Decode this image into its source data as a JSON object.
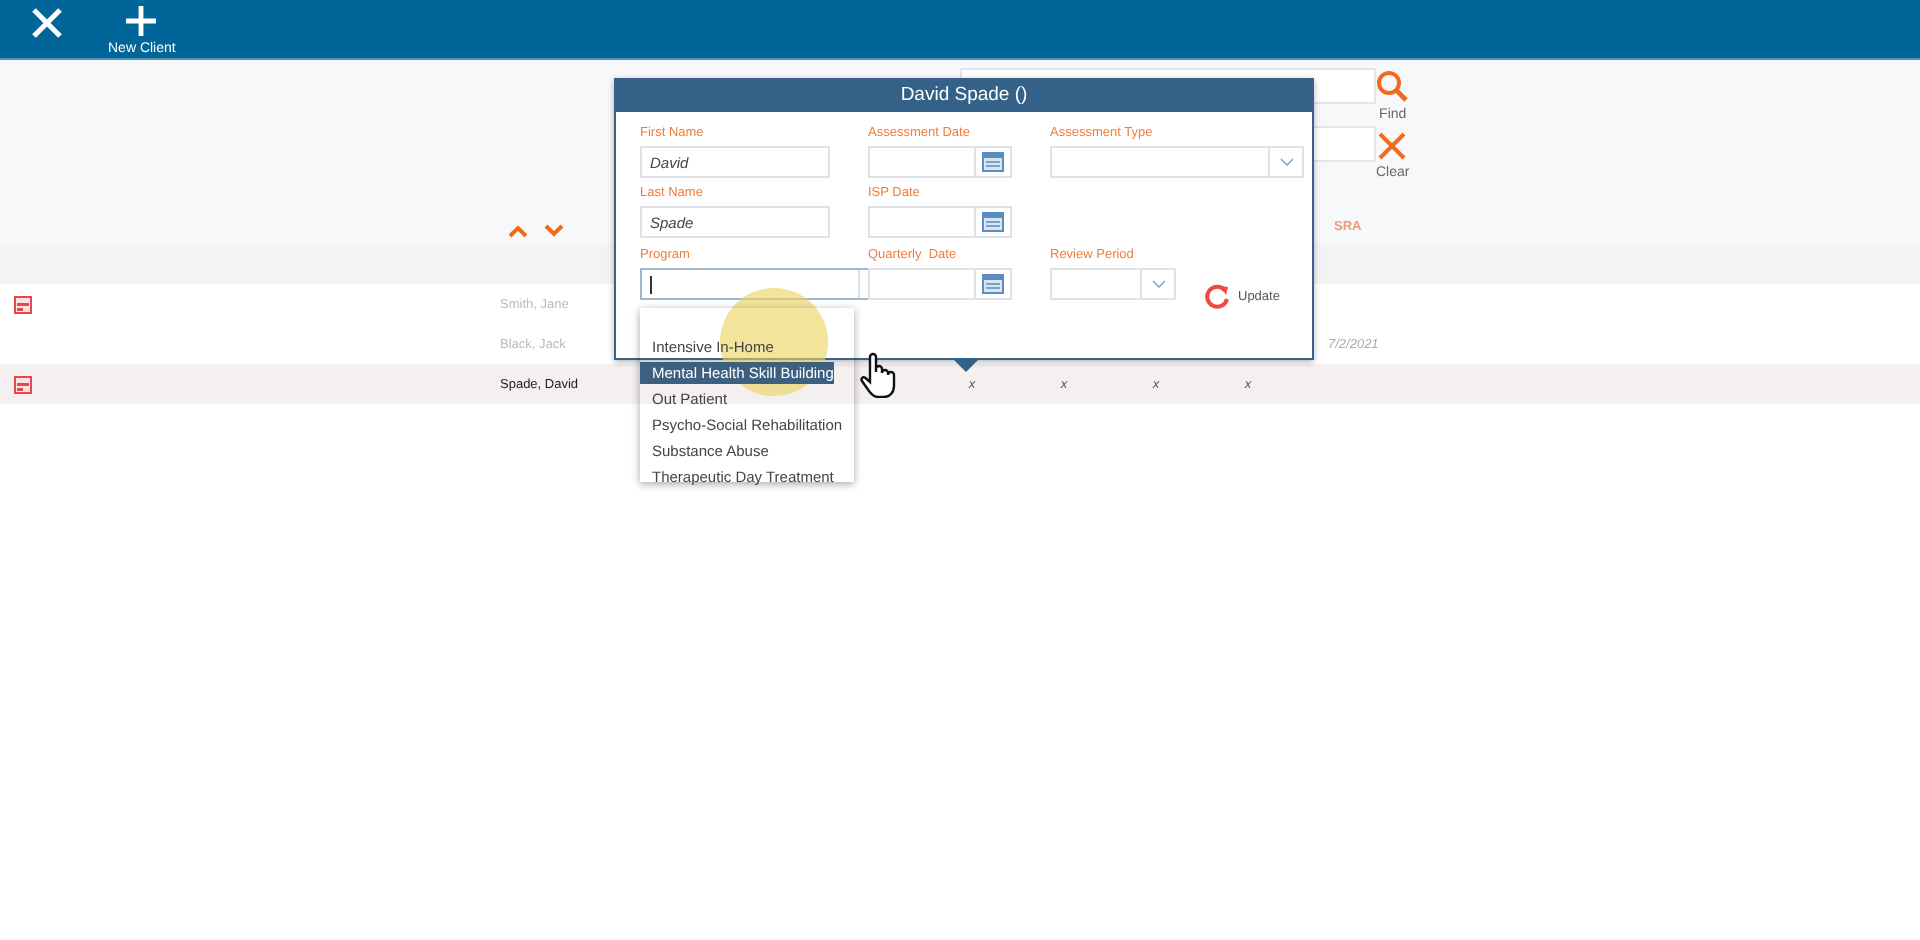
{
  "header": {
    "new_client_label": "New Client"
  },
  "filters": {
    "find_label": "Find",
    "clear_label": "Clear",
    "column_label": "SRA"
  },
  "rows": [
    {
      "name": "Smith, Jane",
      "has_form": true,
      "selected": false
    },
    {
      "name": "Black, Jack",
      "has_form": false,
      "selected": false,
      "date": "7/2/2021"
    },
    {
      "name": "Spade, David",
      "has_form": true,
      "selected": true,
      "cells": [
        "x",
        "x",
        "x",
        "x"
      ]
    }
  ],
  "popup": {
    "title": "David Spade ()",
    "update_label": "Update",
    "fields": [
      {
        "label": "First Name",
        "kind": "text",
        "value": "David"
      },
      {
        "label": "Assessment Date",
        "kind": "date"
      },
      {
        "label": "Assessment Type",
        "kind": "select"
      },
      {
        "label": "Last Name",
        "kind": "text",
        "value": "Spade"
      },
      {
        "label": "ISP Date",
        "kind": "date"
      },
      {
        "label": "Program",
        "kind": "select",
        "focused": true,
        "expanded": true
      },
      {
        "label": "Quarterly  Date",
        "kind": "date"
      },
      {
        "label": "Review Period",
        "kind": "select"
      }
    ],
    "options": [
      {
        "label": "Intensive In-Home",
        "selected": false
      },
      {
        "label": "Mental Health Skill Building",
        "selected": true
      },
      {
        "label": "Out Patient",
        "selected": false
      },
      {
        "label": "Psycho-Social Rehabilitation",
        "selected": false
      },
      {
        "label": "Substance Abuse",
        "selected": false
      },
      {
        "label": "Therapeutic Day Treatment",
        "selected": false
      }
    ]
  }
}
